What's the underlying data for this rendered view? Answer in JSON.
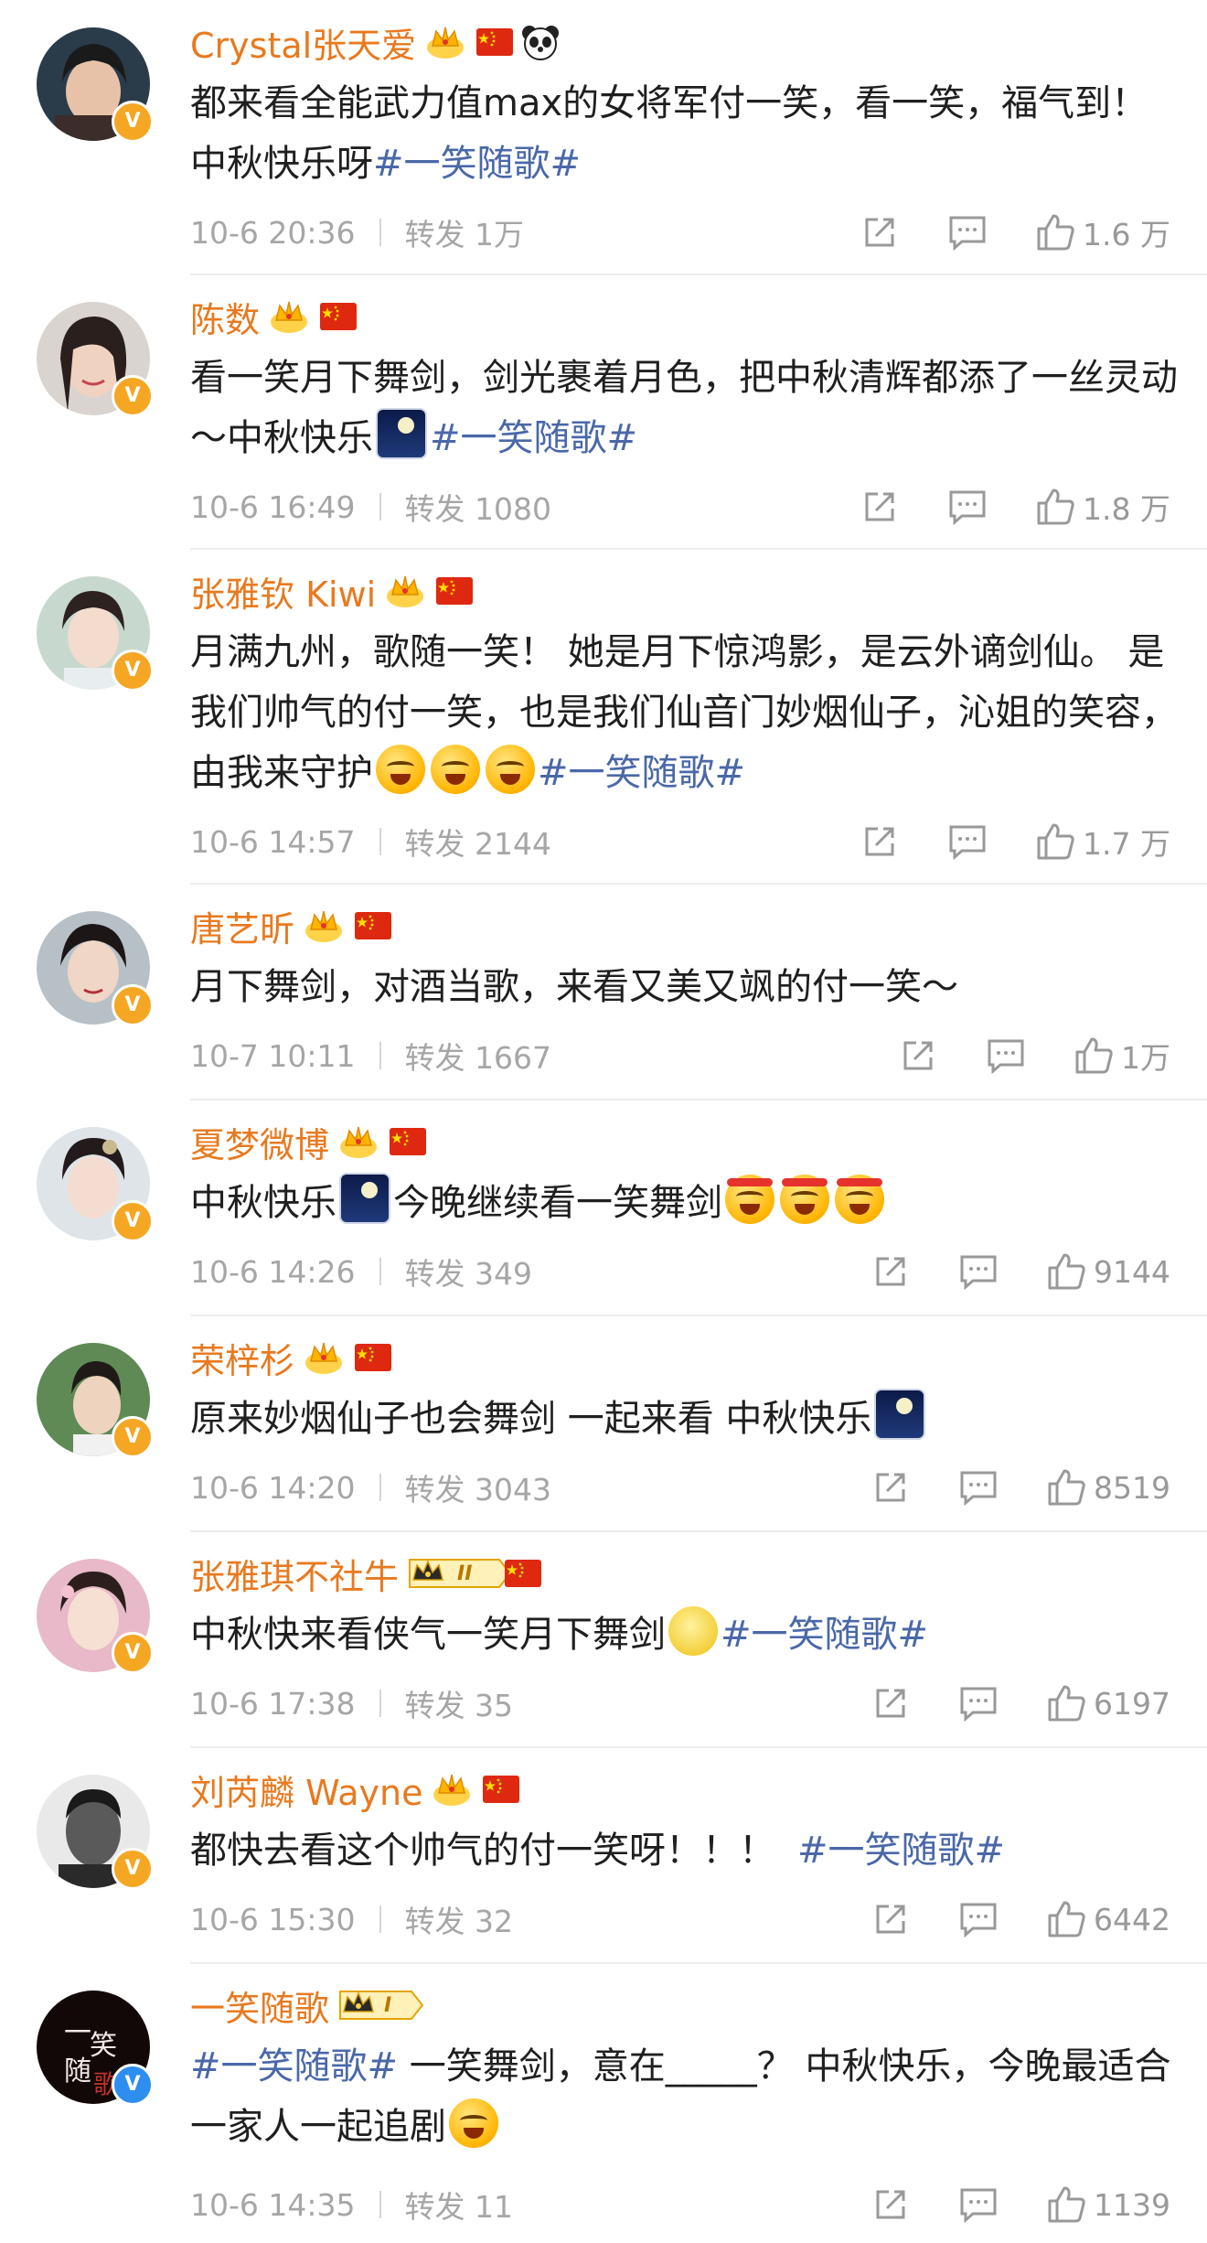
{
  "posts": [
    {
      "name": "Crystal张天爱",
      "text": "都来看全能武力值max的女将军付一笑，看一笑，福气到！中秋快乐呀",
      "tag": "#一笑随歌#",
      "time": "10-6 20:36",
      "repost": "转发 1万",
      "likes": "1.6 万"
    },
    {
      "name": "陈数",
      "text": "看一笑月下舞剑，剑光裹着月色，把中秋清辉都添了一丝灵动～中秋快乐",
      "tag": "#一笑随歌#",
      "time": "10-6 16:49",
      "repost": "转发 1080",
      "likes": "1.8 万"
    },
    {
      "name": "张雅钦 Kiwi",
      "text": "月满九州，歌随一笑！ 她是月下惊鸿影，是云外谪剑仙。 是我们帅气的付一笑，也是我们仙音门妙烟仙子，沁姐的笑容，由我来守护",
      "tag": "#一笑随歌#",
      "time": "10-6 14:57",
      "repost": "转发 2144",
      "likes": "1.7 万"
    },
    {
      "name": "唐艺昕",
      "text": "月下舞剑，对酒当歌，来看又美又飒的付一笑～",
      "tag": "",
      "time": "10-7 10:11",
      "repost": "转发 1667",
      "likes": "1万"
    },
    {
      "name": "夏梦微博",
      "text": "中秋快乐",
      "text2": "今晚继续看一笑舞剑",
      "tag": "",
      "time": "10-6 14:26",
      "repost": "转发 349",
      "likes": "9144"
    },
    {
      "name": "荣梓杉",
      "text": "原来妙烟仙子也会舞剑 一起来看 中秋快乐",
      "tag": "",
      "time": "10-6 14:20",
      "repost": "转发 3043",
      "likes": "8519"
    },
    {
      "name": "张雅琪不社牛",
      "level": "II",
      "text": "中秋快来看侠气一笑月下舞剑",
      "tag": "#一笑随歌#",
      "time": "10-6 17:38",
      "repost": "转发 35",
      "likes": "6197"
    },
    {
      "name": "刘芮麟 Wayne",
      "text": "都快去看这个帅气的付一笑呀！！！",
      "tag": "#一笑随歌#",
      "time": "10-6 15:30",
      "repost": "转发 32",
      "likes": "6442"
    },
    {
      "name": "一笑随歌",
      "level": "I",
      "tag": "#一笑随歌#",
      "text": " 一笑舞剑，意在_____？ 中秋快乐，今晚最适合一家人一起追剧",
      "time": "10-6 14:35",
      "repost": "转发 11",
      "likes": "1139"
    }
  ],
  "icons": {
    "share": "share-icon",
    "comment": "comment-icon",
    "like": "like-icon",
    "crown": "crown-icon",
    "flag": "china-flag-icon",
    "panda": "panda-icon"
  },
  "colors": {
    "name": "#e8791e",
    "tag": "#4a68a8",
    "meta": "#a6a6a6",
    "verified_orange": "#f5a623",
    "verified_blue": "#2d8ef0"
  }
}
